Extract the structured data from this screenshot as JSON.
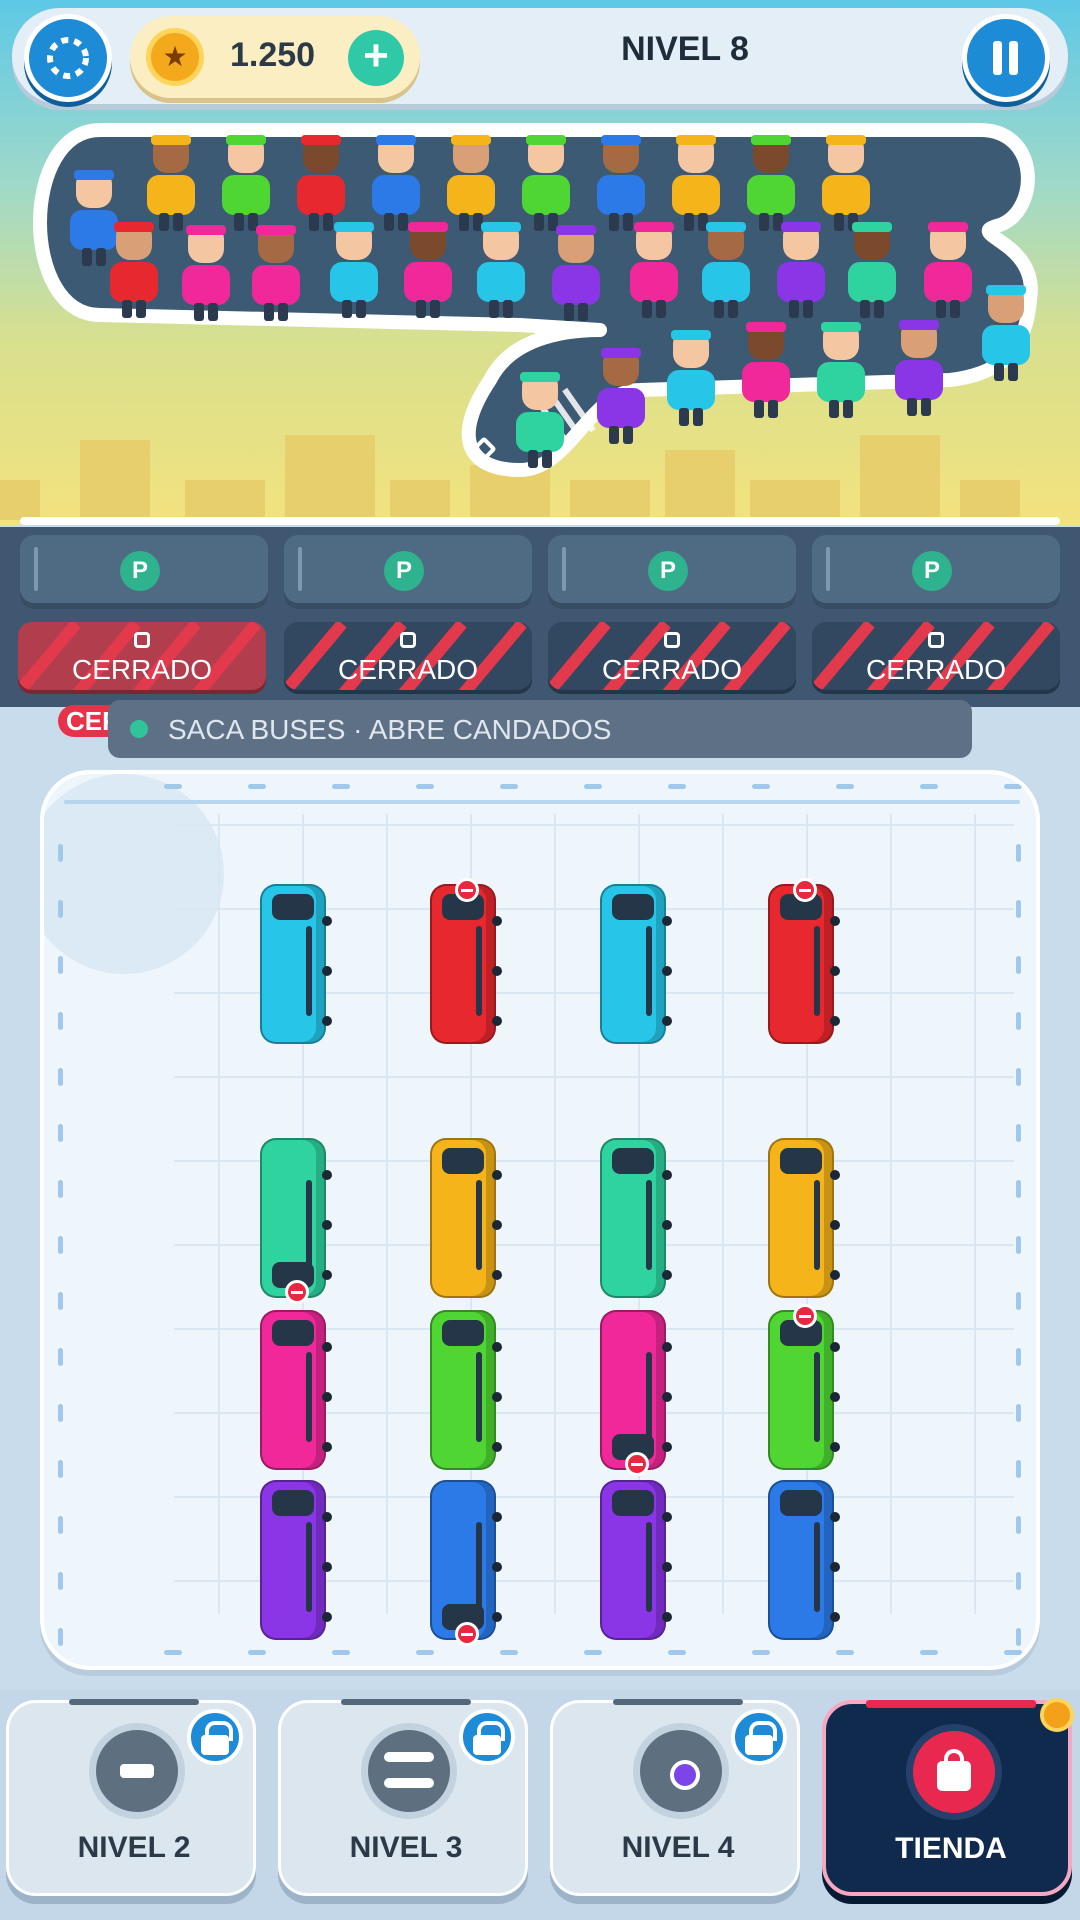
{
  "header": {
    "coins": "1.250",
    "level_title": "NIVEL 8",
    "plus_icon": "+",
    "coin_icon": "★"
  },
  "parking": {
    "slots": [
      "P",
      "P",
      "P",
      "P"
    ],
    "locked_label": "CERRADO",
    "overlap_label": "CERRADO"
  },
  "hint": {
    "text": "SACA BUSES  ·  ABRE CANDADOS"
  },
  "board": {
    "buses": [
      {
        "color": "#27c6e8",
        "row": 0,
        "col": 0,
        "stop": false
      },
      {
        "color": "#e8282f",
        "row": 0,
        "col": 1,
        "stop": "top"
      },
      {
        "color": "#27c6e8",
        "row": 0,
        "col": 2,
        "stop": false
      },
      {
        "color": "#e8282f",
        "row": 0,
        "col": 3,
        "stop": "top"
      },
      {
        "color": "#2fd3a0",
        "row": 1,
        "col": 0,
        "stop": "bottom"
      },
      {
        "color": "#f5b41a",
        "row": 1,
        "col": 1,
        "stop": false
      },
      {
        "color": "#2fd3a0",
        "row": 1,
        "col": 2,
        "stop": false
      },
      {
        "color": "#f5b41a",
        "row": 1,
        "col": 3,
        "stop": false
      },
      {
        "color": "#f0289a",
        "row": 2,
        "col": 0,
        "stop": false
      },
      {
        "color": "#4fd633",
        "row": 2,
        "col": 1,
        "stop": false
      },
      {
        "color": "#f0289a",
        "row": 2,
        "col": 2,
        "stop": "bottom"
      },
      {
        "color": "#4fd633",
        "row": 2,
        "col": 3,
        "stop": "top"
      },
      {
        "color": "#8a35e6",
        "row": 3,
        "col": 0,
        "stop": false
      },
      {
        "color": "#2b7ae8",
        "row": 3,
        "col": 1,
        "stop": "bottom"
      },
      {
        "color": "#8a35e6",
        "row": 3,
        "col": 2,
        "stop": false
      },
      {
        "color": "#2b7ae8",
        "row": 3,
        "col": 3,
        "stop": false
      }
    ]
  },
  "queue": {
    "people": [
      {
        "body": "#2b7ae8",
        "cap": "#2b7ae8"
      },
      {
        "body": "#f5b41a",
        "cap": "#f5b41a"
      },
      {
        "body": "#4fd633",
        "cap": "#4fd633"
      },
      {
        "body": "#e8282f",
        "cap": "#e8282f"
      },
      {
        "body": "#2b7ae8",
        "cap": "#2b7ae8"
      },
      {
        "body": "#f5b41a",
        "cap": "#f5b41a"
      },
      {
        "body": "#4fd633",
        "cap": "#4fd633"
      },
      {
        "body": "#2b7ae8",
        "cap": "#2b7ae8"
      },
      {
        "body": "#f5b41a",
        "cap": "#f5b41a"
      },
      {
        "body": "#4fd633",
        "cap": "#4fd633"
      },
      {
        "body": "#f5b41a",
        "cap": "#f5b41a"
      },
      {
        "body": "#e8282f",
        "cap": "#e8282f"
      },
      {
        "body": "#f0289a",
        "cap": "#f0289a"
      },
      {
        "body": "#f0289a",
        "cap": "#f0289a"
      },
      {
        "body": "#27c6e8",
        "cap": "#27c6e8"
      },
      {
        "body": "#f0289a",
        "cap": "#f0289a"
      },
      {
        "body": "#27c6e8",
        "cap": "#27c6e8"
      },
      {
        "body": "#8a35e6",
        "cap": "#8a35e6"
      },
      {
        "body": "#f0289a",
        "cap": "#f0289a"
      },
      {
        "body": "#27c6e8",
        "cap": "#27c6e8"
      },
      {
        "body": "#8a35e6",
        "cap": "#8a35e6"
      },
      {
        "body": "#2fd3a0",
        "cap": "#2fd3a0"
      },
      {
        "body": "#f0289a",
        "cap": "#f0289a"
      },
      {
        "body": "#27c6e8",
        "cap": "#27c6e8"
      },
      {
        "body": "#2fd3a0",
        "cap": "#2fd3a0"
      },
      {
        "body": "#8a35e6",
        "cap": "#8a35e6"
      },
      {
        "body": "#27c6e8",
        "cap": "#27c6e8"
      },
      {
        "body": "#f0289a",
        "cap": "#f0289a"
      },
      {
        "body": "#2fd3a0",
        "cap": "#2fd3a0"
      },
      {
        "body": "#8a35e6",
        "cap": "#8a35e6"
      }
    ]
  },
  "footer": {
    "cards": [
      {
        "label": "NIVEL 2",
        "icon": "dumbbell-icon",
        "locked": true
      },
      {
        "label": "NIVEL 3",
        "icon": "toggle-icon",
        "locked": true
      },
      {
        "label": "NIVEL 4",
        "icon": "orb-icon",
        "locked": true
      },
      {
        "label": "TIENDA",
        "icon": "shopping-bag-icon",
        "locked": false
      }
    ]
  }
}
